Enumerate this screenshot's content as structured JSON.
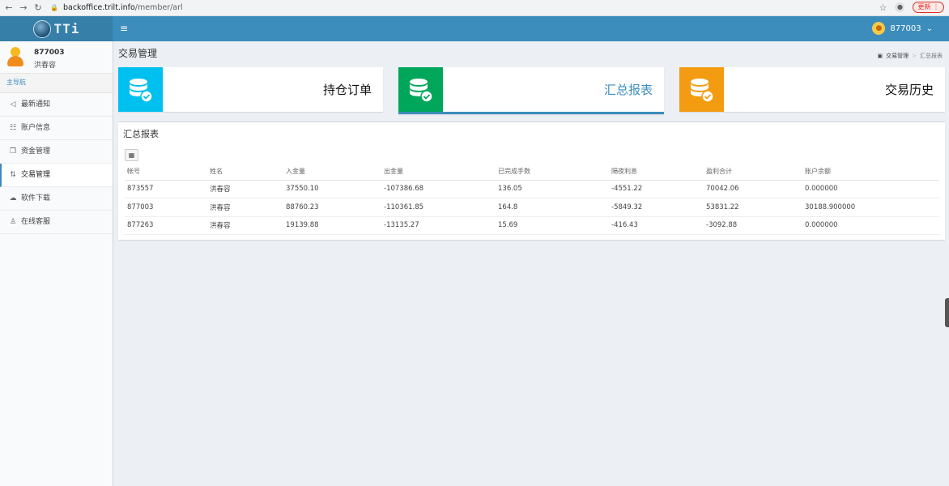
{
  "browser": {
    "url_host": "backoffice.trilt.info",
    "url_path": "/member/arl",
    "update_label": "更新"
  },
  "topbar": {
    "logo_text": "TTi",
    "username": "877003"
  },
  "sidebar": {
    "user_id": "877003",
    "user_name": "洪春容",
    "nav_header": "主导航",
    "items": [
      {
        "label": "最新通知",
        "icon": "megaphone-icon"
      },
      {
        "label": "账户信息",
        "icon": "user-card-icon"
      },
      {
        "label": "资金管理",
        "icon": "copy-icon"
      },
      {
        "label": "交易管理",
        "icon": "exchange-icon"
      },
      {
        "label": "软件下载",
        "icon": "cloud-download-icon"
      },
      {
        "label": "在线客服",
        "icon": "support-icon"
      }
    ]
  },
  "content": {
    "header": "交易管理",
    "breadcrumb": [
      "交易管理",
      "汇总报表"
    ]
  },
  "infoboxes": [
    {
      "label": "持仓订单",
      "color": "#00c0ef"
    },
    {
      "label": "汇总报表",
      "color": "#00a65a"
    },
    {
      "label": "交易历史",
      "color": "#f39c12"
    }
  ],
  "report": {
    "title": "汇总报表",
    "columns": [
      "帐号",
      "姓名",
      "入金量",
      "出金量",
      "已完成手数",
      "隔夜利息",
      "盈利合计",
      "账户余额"
    ],
    "rows": [
      [
        "873557",
        "洪春容",
        "37550.10",
        "-107386.68",
        "136.05",
        "-4551.22",
        "70042.06",
        "0.000000"
      ],
      [
        "877003",
        "洪春容",
        "88760.23",
        "-110361.85",
        "164.8",
        "-5849.32",
        "53831.22",
        "30188.900000"
      ],
      [
        "877263",
        "洪春容",
        "19139.88",
        "-13135.27",
        "15.69",
        "-416.43",
        "-3092.88",
        "0.000000"
      ]
    ]
  }
}
